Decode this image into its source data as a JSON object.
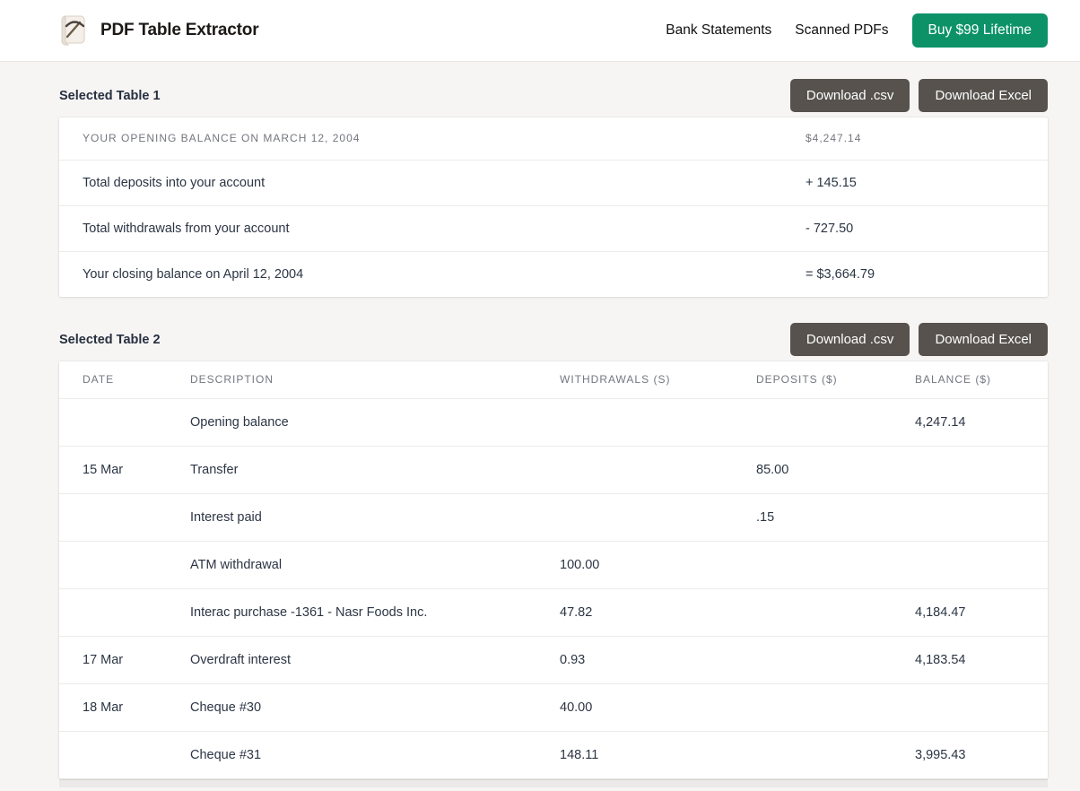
{
  "header": {
    "logo_icon": "pickaxe-scroll-icon",
    "title": "PDF Table Extractor",
    "nav": [
      {
        "label": "Bank Statements"
      },
      {
        "label": "Scanned PDFs"
      }
    ],
    "cta_label": "Buy $99 Lifetime"
  },
  "colors": {
    "accent_green": "#0d9268",
    "download_button": "#57524d",
    "page_background": "#f6f5f4",
    "muted_header_text": "#74777f",
    "cell_text": "#2b3544"
  },
  "sections": [
    {
      "title": "Selected Table 1",
      "buttons": [
        {
          "label": "Download .csv"
        },
        {
          "label": "Download Excel"
        }
      ],
      "table": {
        "header": [
          "YOUR OPENING BALANCE ON MARCH 12, 2004",
          "$4,247.14"
        ],
        "rows": [
          [
            "Total deposits into your account",
            "+ 145.15"
          ],
          [
            "Total withdrawals from your account",
            "- 727.50"
          ],
          [
            "Your closing balance on April 12, 2004",
            "= $3,664.79"
          ]
        ]
      }
    },
    {
      "title": "Selected Table 2",
      "buttons": [
        {
          "label": "Download .csv"
        },
        {
          "label": "Download Excel"
        }
      ],
      "table": {
        "columns": [
          "DATE",
          "DESCRIPTION",
          "WITHDRAWALS (S)",
          "DEPOSITS ($)",
          "BALANCE ($)"
        ],
        "rows": [
          [
            "",
            "Opening balance",
            "",
            "",
            "4,247.14"
          ],
          [
            "15 Mar",
            "Transfer",
            "",
            "85.00",
            ""
          ],
          [
            "",
            "Interest paid",
            "",
            ".15",
            ""
          ],
          [
            "",
            "ATM withdrawal",
            "100.00",
            "",
            ""
          ],
          [
            "",
            "Interac purchase -1361 - Nasr Foods Inc.",
            "47.82",
            "",
            "4,184.47"
          ],
          [
            "17 Mar",
            "Overdraft interest",
            "0.93",
            "",
            "4,183.54"
          ],
          [
            "18 Mar",
            "Cheque #30",
            "40.00",
            "",
            ""
          ],
          [
            "",
            "Cheque #31",
            "148.11",
            "",
            "3,995.43"
          ]
        ]
      }
    }
  ]
}
